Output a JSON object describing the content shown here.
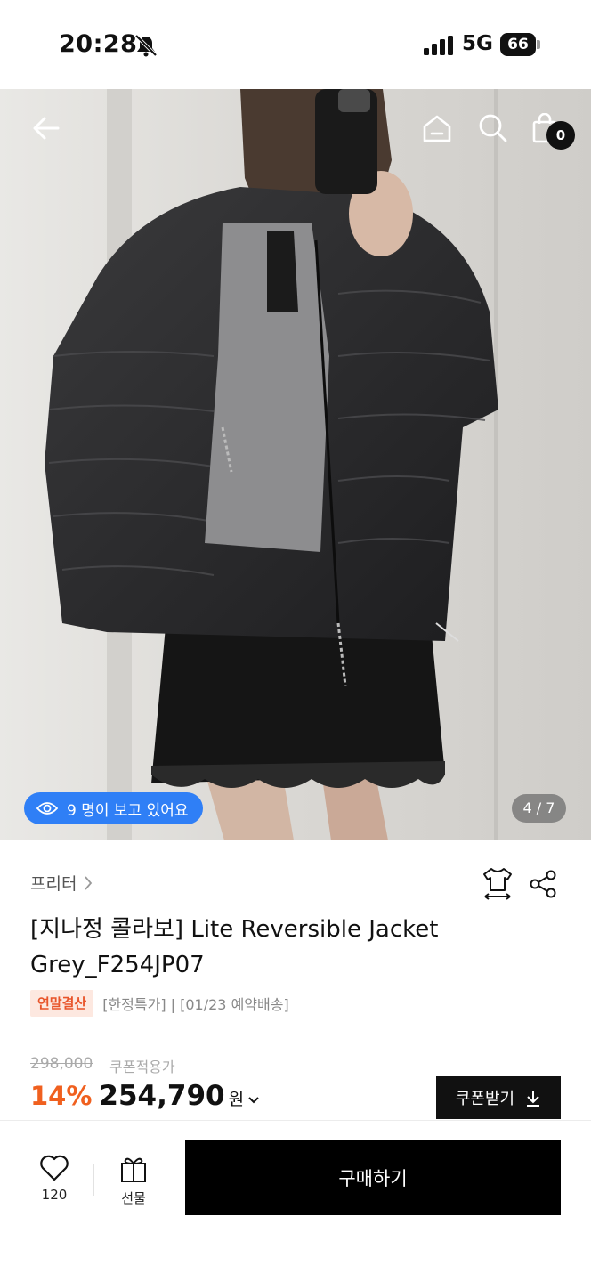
{
  "status_bar": {
    "time": "20:28",
    "network": "5G",
    "battery": "66",
    "icons": [
      "bell-off-icon",
      "signal-icon",
      "battery-icon"
    ]
  },
  "hero": {
    "icons": [
      "back-arrow-icon",
      "home-icon",
      "search-icon",
      "cart-icon"
    ],
    "cart_count": "0",
    "viewers_text": "9 명이 보고 있어요",
    "page_counter": "4 / 7"
  },
  "product": {
    "brand": "프리터",
    "title_line1": "[지나정 콜라보] Lite Reversible Jacket",
    "title_line2": "Grey_F254JP07",
    "tag_highlight": "연말결산",
    "tag_text": "[한정특가] | [01/23 예약배송]",
    "original_price": "298,000",
    "coupon_price_label": "쿠폰적용가",
    "discount": "14%",
    "sale_price": "254,790",
    "currency": "원",
    "coupon_button": "쿠폰받기"
  },
  "bottom_bar": {
    "like_count": "120",
    "gift_label": "선물",
    "buy_label": "구매하기"
  },
  "colors": {
    "accent_orange": "#f0601f",
    "viewers_blue": "#2f7ff6",
    "tag_bg": "#fde8e0",
    "black": "#111111"
  }
}
